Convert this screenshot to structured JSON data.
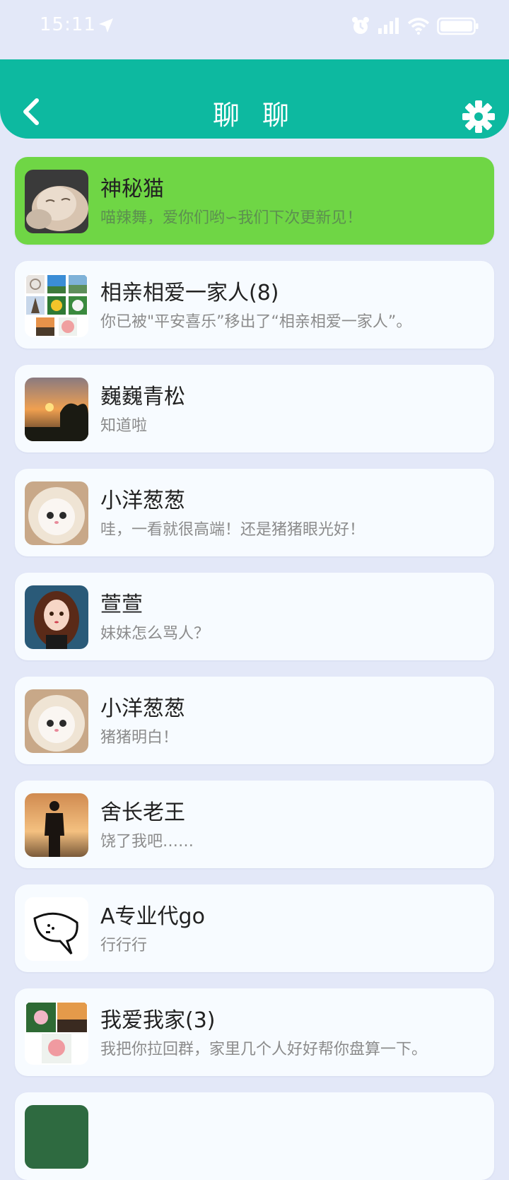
{
  "status_bar": {
    "time": "15:11"
  },
  "header": {
    "title": "聊 聊",
    "accent_color": "#0db9a0"
  },
  "chats": [
    {
      "name": "神秘猫",
      "message": "喵辣舞，爱你们哟∽我们下次更新见！",
      "avatar": "cat-photo-avatar",
      "active": true
    },
    {
      "name": "相亲相爱一家人(8)",
      "message": "你已被\"平安喜乐”移出了“相亲相爱一家人”。",
      "avatar": "group-grid-avatar"
    },
    {
      "name": "巍巍青松",
      "message": "知道啦",
      "avatar": "sunset-avatar"
    },
    {
      "name": "小洋葱葱",
      "message": "哇，一看就很高端！还是猪猪眼光好！",
      "avatar": "white-cat-avatar"
    },
    {
      "name": "萱萱",
      "message": "妹妹怎么骂人？",
      "avatar": "girl-avatar"
    },
    {
      "name": "小洋葱葱",
      "message": "猪猪明白！",
      "avatar": "white-cat-avatar"
    },
    {
      "name": "舍长老王",
      "message": "饶了我吧……",
      "avatar": "silhouette-avatar"
    },
    {
      "name": "A专业代go",
      "message": "行行行",
      "avatar": "speech-bubble-avatar"
    },
    {
      "name": "我爱我家(3)",
      "message": "我把你拉回群，家里几个人好好帮你盘算一下。",
      "avatar": "group-grid-avatar-small"
    }
  ]
}
